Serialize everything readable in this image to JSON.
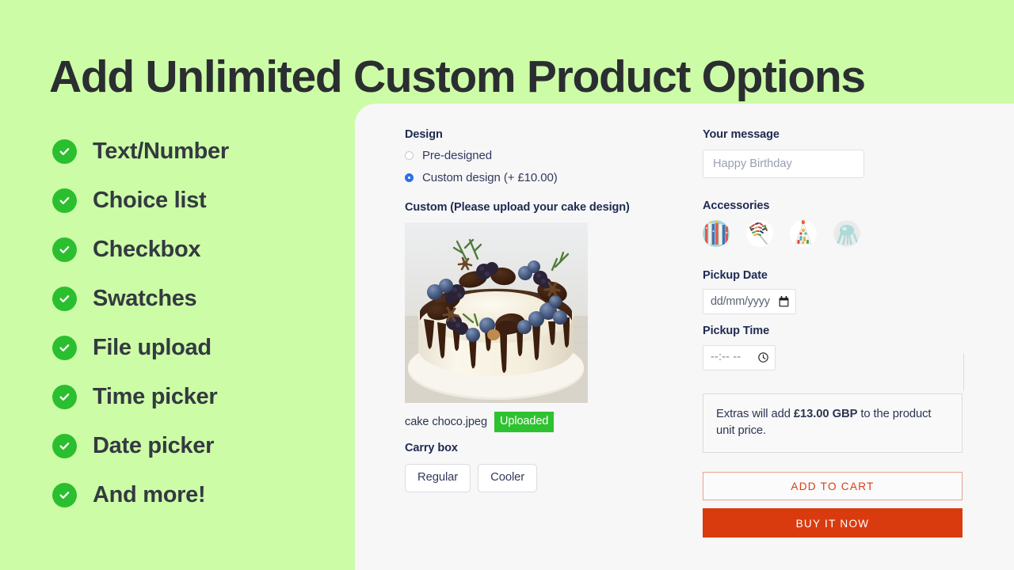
{
  "hero": {
    "title": "Add Unlimited Custom Product Options",
    "background_color": "#CDFCA7",
    "title_color": "#2B2E31"
  },
  "features": {
    "check_icon": "check-circle-icon",
    "check_color": "#2BBF2F",
    "items": [
      {
        "label": "Text/Number"
      },
      {
        "label": "Choice list"
      },
      {
        "label": "Checkbox"
      },
      {
        "label": "Swatches"
      },
      {
        "label": "File upload"
      },
      {
        "label": "Time picker"
      },
      {
        "label": "Date picker"
      },
      {
        "label": "And more!"
      }
    ]
  },
  "product_form": {
    "background_color": "#F7F7F8",
    "design": {
      "label": "Design",
      "options": [
        {
          "label": "Pre-designed",
          "selected": false
        },
        {
          "label": "Custom design (+ £10.00)",
          "selected": true
        }
      ],
      "selected_color": "#2B6FE8"
    },
    "upload": {
      "label": "Custom (Please upload your cake design)",
      "image_alt": "chocolate drip cake with berries and cookies",
      "file_name": "cake choco.jpeg",
      "status_badge": "Uploaded",
      "badge_color": "#2FC230"
    },
    "carry_box": {
      "label": "Carry box",
      "options": [
        {
          "label": "Regular"
        },
        {
          "label": "Cooler"
        }
      ]
    },
    "message": {
      "label": "Your message",
      "value": "",
      "placeholder": "Happy Birthday"
    },
    "accessories": {
      "label": "Accessories",
      "swatches": [
        {
          "name": "candles-swatch"
        },
        {
          "name": "sprinkles-swatch"
        },
        {
          "name": "party-hat-swatch"
        },
        {
          "name": "balloon-swatch"
        }
      ]
    },
    "pickup_date": {
      "label": "Pickup Date",
      "value": "dd/mm/yyyy",
      "icon": "calendar-icon"
    },
    "pickup_time": {
      "label": "Pickup Time",
      "value": "--:-- --",
      "icon": "clock-icon"
    },
    "extras_notice": {
      "prefix": "Extras will add ",
      "amount": "£13.00 GBP",
      "suffix": " to the product unit price."
    },
    "actions": {
      "add_to_cart": "ADD TO CART",
      "buy_it_now": "BUY IT NOW",
      "accent_color": "#D93B0F"
    }
  }
}
